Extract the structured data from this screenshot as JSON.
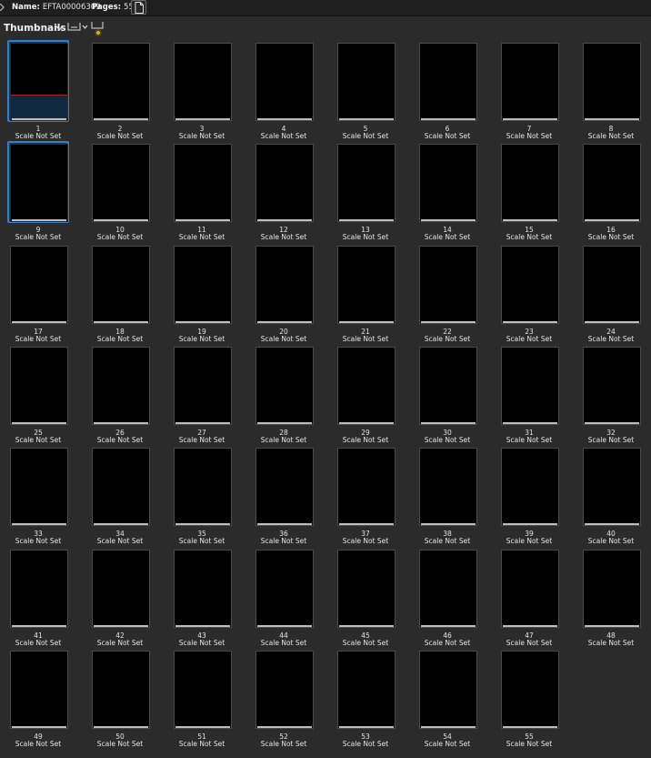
{
  "header": {
    "name_label": "Name:",
    "name_value": "EFTA00006309",
    "pages_label": "Pages:",
    "pages_value": "55",
    "doc_icon": "document-icon"
  },
  "toolbar": {
    "title": "Thumbnails",
    "menu_icon": "chevron-down-icon",
    "size_icon": "thumbnail-size-icon",
    "brightness_icon": "brightness-icon"
  },
  "colors": {
    "background": "#2b2b2b",
    "selection": "#2f7fd0",
    "page": "#000000"
  },
  "selected_pages": [
    1,
    9
  ],
  "thumbnails": [
    {
      "page": "1",
      "scale": "Scale Not Set"
    },
    {
      "page": "2",
      "scale": "Scale Not Set"
    },
    {
      "page": "3",
      "scale": "Scale Not Set"
    },
    {
      "page": "4",
      "scale": "Scale Not Set"
    },
    {
      "page": "5",
      "scale": "Scale Not Set"
    },
    {
      "page": "6",
      "scale": "Scale Not Set"
    },
    {
      "page": "7",
      "scale": "Scale Not Set"
    },
    {
      "page": "8",
      "scale": "Scale Not Set"
    },
    {
      "page": "9",
      "scale": "Scale Not Set"
    },
    {
      "page": "10",
      "scale": "Scale Not Set"
    },
    {
      "page": "11",
      "scale": "Scale Not Set"
    },
    {
      "page": "12",
      "scale": "Scale Not Set"
    },
    {
      "page": "13",
      "scale": "Scale Not Set"
    },
    {
      "page": "14",
      "scale": "Scale Not Set"
    },
    {
      "page": "15",
      "scale": "Scale Not Set"
    },
    {
      "page": "16",
      "scale": "Scale Not Set"
    },
    {
      "page": "17",
      "scale": "Scale Not Set"
    },
    {
      "page": "18",
      "scale": "Scale Not Set"
    },
    {
      "page": "19",
      "scale": "Scale Not Set"
    },
    {
      "page": "20",
      "scale": "Scale Not Set"
    },
    {
      "page": "21",
      "scale": "Scale Not Set"
    },
    {
      "page": "22",
      "scale": "Scale Not Set"
    },
    {
      "page": "23",
      "scale": "Scale Not Set"
    },
    {
      "page": "24",
      "scale": "Scale Not Set"
    },
    {
      "page": "25",
      "scale": "Scale Not Set"
    },
    {
      "page": "26",
      "scale": "Scale Not Set"
    },
    {
      "page": "27",
      "scale": "Scale Not Set"
    },
    {
      "page": "28",
      "scale": "Scale Not Set"
    },
    {
      "page": "29",
      "scale": "Scale Not Set"
    },
    {
      "page": "30",
      "scale": "Scale Not Set"
    },
    {
      "page": "31",
      "scale": "Scale Not Set"
    },
    {
      "page": "32",
      "scale": "Scale Not Set"
    },
    {
      "page": "33",
      "scale": "Scale Not Set"
    },
    {
      "page": "34",
      "scale": "Scale Not Set"
    },
    {
      "page": "35",
      "scale": "Scale Not Set"
    },
    {
      "page": "36",
      "scale": "Scale Not Set"
    },
    {
      "page": "37",
      "scale": "Scale Not Set"
    },
    {
      "page": "38",
      "scale": "Scale Not Set"
    },
    {
      "page": "39",
      "scale": "Scale Not Set"
    },
    {
      "page": "40",
      "scale": "Scale Not Set"
    },
    {
      "page": "41",
      "scale": "Scale Not Set"
    },
    {
      "page": "42",
      "scale": "Scale Not Set"
    },
    {
      "page": "43",
      "scale": "Scale Not Set"
    },
    {
      "page": "44",
      "scale": "Scale Not Set"
    },
    {
      "page": "45",
      "scale": "Scale Not Set"
    },
    {
      "page": "46",
      "scale": "Scale Not Set"
    },
    {
      "page": "47",
      "scale": "Scale Not Set"
    },
    {
      "page": "48",
      "scale": "Scale Not Set"
    },
    {
      "page": "49",
      "scale": "Scale Not Set"
    },
    {
      "page": "50",
      "scale": "Scale Not Set"
    },
    {
      "page": "51",
      "scale": "Scale Not Set"
    },
    {
      "page": "52",
      "scale": "Scale Not Set"
    },
    {
      "page": "53",
      "scale": "Scale Not Set"
    },
    {
      "page": "54",
      "scale": "Scale Not Set"
    },
    {
      "page": "55",
      "scale": "Scale Not Set"
    }
  ]
}
